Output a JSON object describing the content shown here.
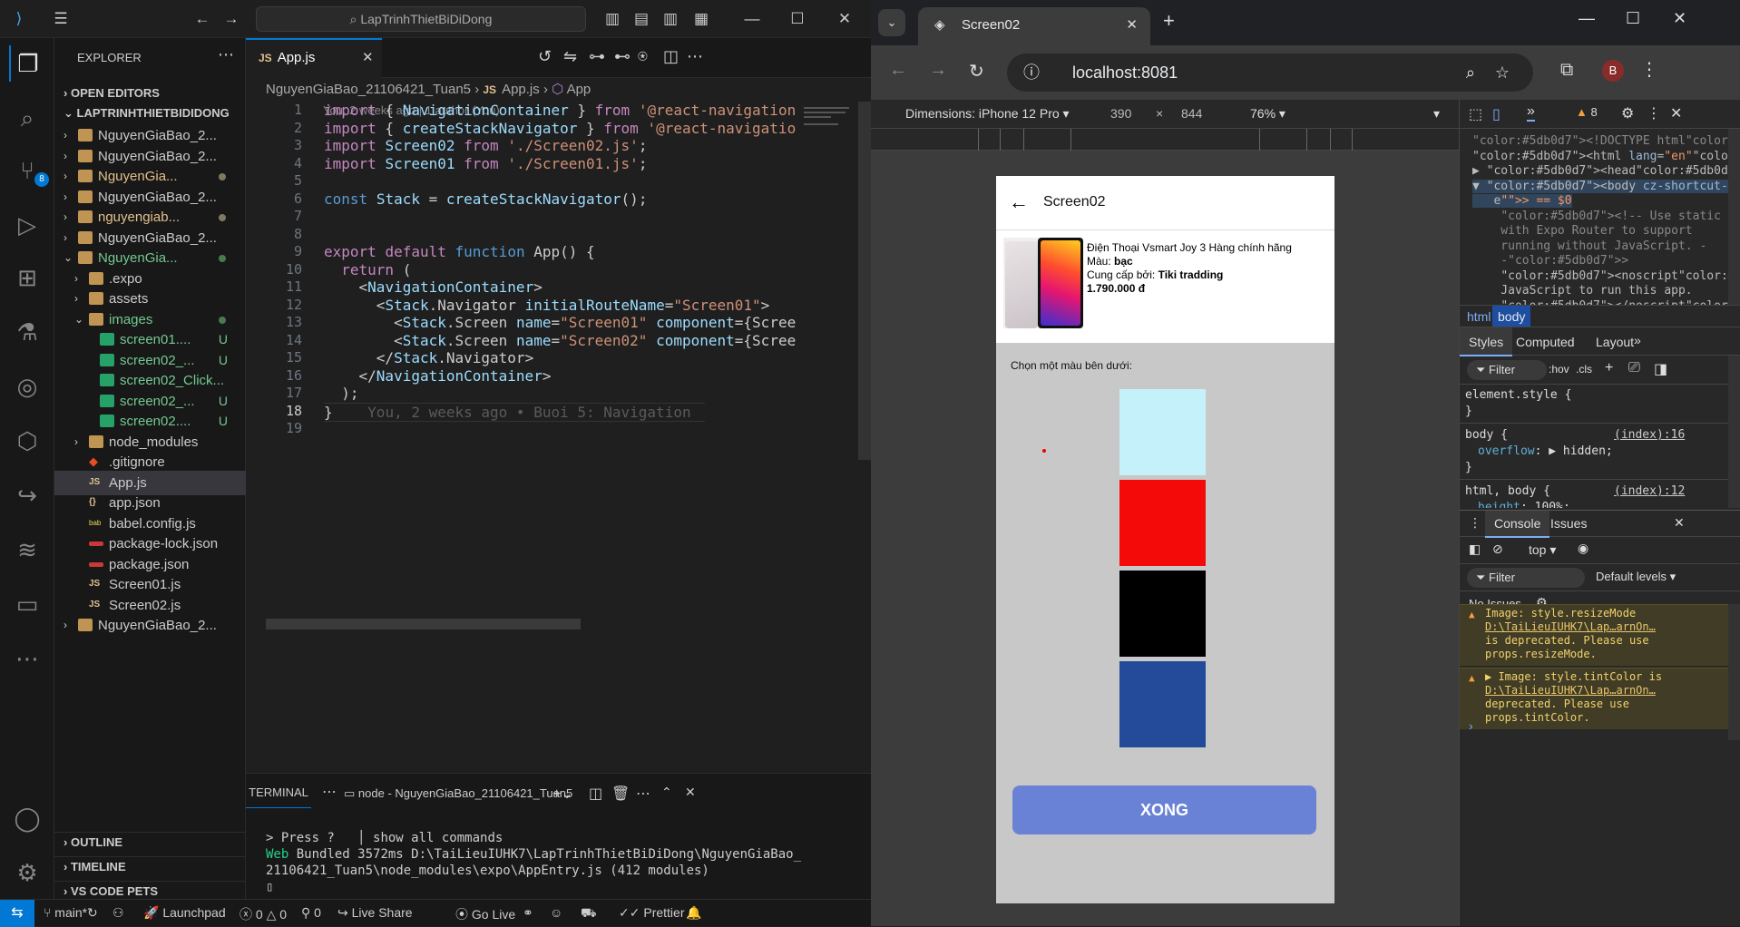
{
  "vscode": {
    "search_text": "LapTrinhThietBiDiDong",
    "source_control_badge": "8",
    "explorer_title": "EXPLORER",
    "sections": {
      "open_editors": "OPEN EDITORS",
      "root": "LAPTRINHTHIETBIDIDONG",
      "outline": "OUTLINE",
      "timeline": "TIMELINE",
      "pets": "VS CODE PETS"
    },
    "tree": [
      {
        "label": "NguyenGiaBao_2...",
        "type": "folder",
        "depth": 0,
        "open": false,
        "status": ""
      },
      {
        "label": "NguyenGiaBao_2...",
        "type": "folder",
        "depth": 0,
        "open": false,
        "status": ""
      },
      {
        "label": "NguyenGia...",
        "type": "folder",
        "depth": 0,
        "open": false,
        "status": "dot-yellow"
      },
      {
        "label": "NguyenGiaBao_2...",
        "type": "folder",
        "depth": 0,
        "open": false,
        "status": ""
      },
      {
        "label": "nguyengiab...",
        "type": "folder",
        "depth": 0,
        "open": false,
        "status": "dot-yellow"
      },
      {
        "label": "NguyenGiaBao_2...",
        "type": "folder",
        "depth": 0,
        "open": false,
        "status": ""
      },
      {
        "label": "NguyenGia...",
        "type": "folder",
        "depth": 0,
        "open": true,
        "status": "dot-green"
      },
      {
        "label": ".expo",
        "type": "folder",
        "depth": 1,
        "open": false,
        "status": ""
      },
      {
        "label": "assets",
        "type": "folder",
        "depth": 1,
        "open": false,
        "status": ""
      },
      {
        "label": "images",
        "type": "folder",
        "depth": 1,
        "open": true,
        "status": "dot-green"
      },
      {
        "label": "screen01....",
        "type": "image",
        "depth": 2,
        "status": "U"
      },
      {
        "label": "screen02_...",
        "type": "image",
        "depth": 2,
        "status": "U"
      },
      {
        "label": "screen02_Click...",
        "type": "image",
        "depth": 2,
        "status": ""
      },
      {
        "label": "screen02_...",
        "type": "image",
        "depth": 2,
        "status": "U"
      },
      {
        "label": "screen02....",
        "type": "image",
        "depth": 2,
        "status": "U"
      },
      {
        "label": "node_modules",
        "type": "folder",
        "depth": 1,
        "open": false,
        "status": ""
      },
      {
        "label": ".gitignore",
        "type": "git",
        "depth": 1,
        "status": ""
      },
      {
        "label": "App.js",
        "type": "js",
        "depth": 1,
        "status": "",
        "selected": true
      },
      {
        "label": "app.json",
        "type": "json",
        "depth": 1,
        "status": ""
      },
      {
        "label": "babel.config.js",
        "type": "babel",
        "depth": 1,
        "status": ""
      },
      {
        "label": "package-lock.json",
        "type": "npm",
        "depth": 1,
        "status": ""
      },
      {
        "label": "package.json",
        "type": "npm",
        "depth": 1,
        "status": ""
      },
      {
        "label": "Screen01.js",
        "type": "js",
        "depth": 1,
        "status": ""
      },
      {
        "label": "Screen02.js",
        "type": "js",
        "depth": 1,
        "status": ""
      },
      {
        "label": "NguyenGiaBao_2...",
        "type": "folder",
        "depth": 0,
        "open": false,
        "status": ""
      }
    ],
    "tab_label": "App.js",
    "breadcrumb": [
      "NguyenGiaBao_21106421_Tuan5",
      "App.js",
      "App"
    ],
    "blame_header": "You, 2 weeks ago | 1 author (You)",
    "code_lines": [
      "import { NavigationContainer } from '@react-navigation",
      "import { createStackNavigator } from '@react-navigatio",
      "import Screen02 from './Screen02.js';",
      "import Screen01 from './Screen01.js';",
      "",
      "const Stack = createStackNavigator();",
      "",
      "",
      "export default function App() {",
      "  return (",
      "    <NavigationContainer>",
      "      <Stack.Navigator initialRouteName=\"Screen01\">",
      "        <Stack.Screen name=\"Screen01\" component={Scree",
      "        <Stack.Screen name=\"Screen02\" component={Scree",
      "      </Stack.Navigator>",
      "    </NavigationContainer>",
      "  );",
      "}",
      ""
    ],
    "inline_blame": "You, 2 weeks ago • Buoi 5: Navigation",
    "current_line": 18,
    "terminal": {
      "tab": "TERMINAL",
      "shell_label": "node - NguyenGiaBao_21106421_Tuan5",
      "line1_a": "> Press ?",
      "line1_b": "│ show all commands",
      "line2_tag": "Web",
      "line2_text": " Bundled 3572ms D:\\TaiLieuIUHK7\\LapTrinhThietBiDiDong\\NguyenGiaBao_",
      "line3": "21106421_Tuan5\\node_modules\\expo\\AppEntry.js (412 modules)"
    },
    "status": {
      "branch": "main*",
      "launchpad": "Launchpad",
      "errors": "0",
      "warnings": "0",
      "ports": "0",
      "liveshare": "Live Share",
      "golive": "Go Live",
      "prettier": "Prettier"
    }
  },
  "chrome": {
    "tab_title": "Screen02",
    "url": "localhost:8081",
    "profile_initial": "B",
    "device": {
      "dimensions_label": "Dimensions: iPhone 12 Pro",
      "width": "390",
      "height": "844",
      "zoom": "76%"
    },
    "app": {
      "header_title": "Screen02",
      "product_name": "Điện Thoại Vsmart Joy 3 Hàng chính hãng",
      "color_label": "Màu:",
      "color_value": "bạc",
      "seller_label": "Cung cấp bởi:",
      "seller_value": "Tiki tradding",
      "price": "1.790.000 đ",
      "choose_color": "Chọn một màu bên dưới:",
      "swatches": [
        "#c5f1fb",
        "#f50a0a",
        "#000000",
        "#234b9a"
      ],
      "button": "XONG"
    }
  },
  "devtools": {
    "warning_count": "8",
    "elements": [
      "<!DOCTYPE html>",
      "<html lang=\"en\">",
      "▶ <head> ⋯ </head>",
      "▼ <body cz-shortcut-listen=\"tru",
      "   e\"> == $0",
      "    <!-- Use static rendering",
      "    with Expo Router to support",
      "    running without JavaScript. -",
      "    ->",
      "    <noscript> You need to enable",
      "    JavaScript to run this app.",
      "    </noscript>",
      "    <!-- The root element for"
    ],
    "crumbs": [
      "html",
      "body"
    ],
    "style_tabs": [
      "Styles",
      "Computed",
      "Layout"
    ],
    "filter": "Filter",
    "hov": ":hov",
    "cls": ".cls",
    "rules": [
      {
        "selector": "element.style {",
        "props": [],
        "source": ""
      },
      {
        "selector": "body {",
        "props": [
          [
            "overflow",
            "▶ hidden"
          ]
        ],
        "source": "(index):16"
      },
      {
        "selector": "html, body {",
        "props": [
          [
            "height",
            "100%"
          ]
        ],
        "source": "(index):12"
      }
    ],
    "console_tabs": [
      "Console",
      "Issues"
    ],
    "context": "top",
    "levels": "Default levels",
    "no_issues": "No Issues",
    "warnings": [
      {
        "first": "Image: style.resizeMode",
        "link": "D:\\TaiLieuIUHK7\\Lap…arnOn…",
        "rest": [
          "is deprecated. Please use",
          "props.resizeMode."
        ]
      },
      {
        "first": "▶ Image: style.tintColor is",
        "link": "D:\\TaiLieuIUHK7\\Lap…arnOn…",
        "rest": [
          "deprecated. Please use",
          "props.tintColor."
        ]
      }
    ]
  }
}
